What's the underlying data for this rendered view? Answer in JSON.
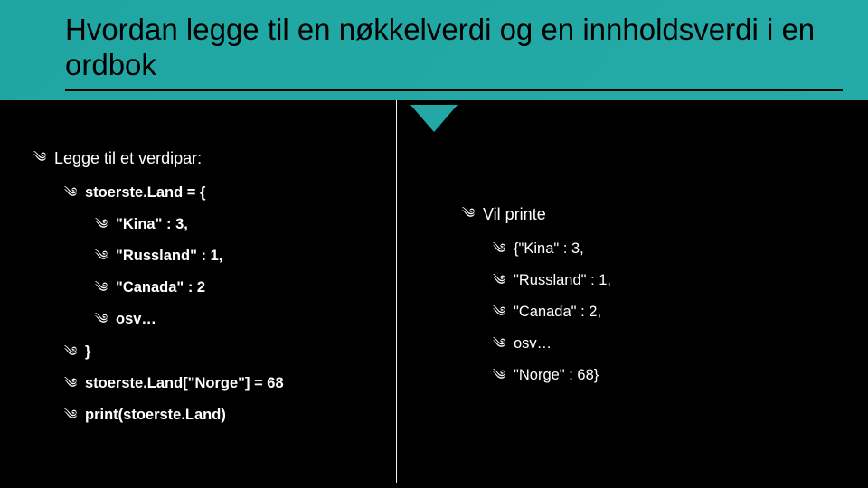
{
  "title": "Hvordan legge til en nøkkelverdi og en innholdsverdi i en ordbok",
  "left": {
    "intro": "Legge til et verdipar:",
    "line1": "stoerste.Land = {",
    "items": [
      "\"Kina\" : 3,",
      "\"Russland\" : 1,",
      "\"Canada\" : 2",
      "osv…"
    ],
    "close": "}",
    "assign": "stoerste.Land[\"Norge\"] = 68",
    "print": "print(stoerste.Land)"
  },
  "right": {
    "intro": "Vil printe",
    "items": [
      "{\"Kina\" : 3,",
      "\"Russland\" : 1,",
      "\"Canada\" : 2,",
      "osv…",
      "\"Norge\" : 68}"
    ]
  }
}
